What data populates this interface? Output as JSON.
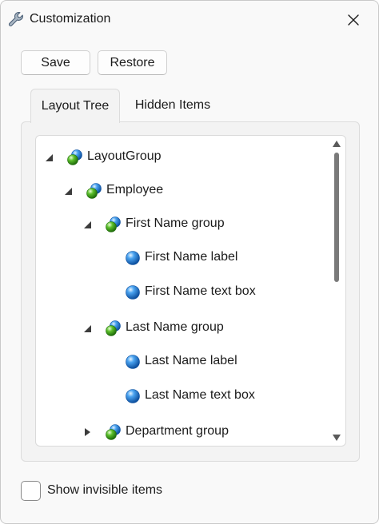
{
  "window": {
    "title": "Customization",
    "icon": "wrench-icon"
  },
  "toolbar": {
    "save_label": "Save",
    "restore_label": "Restore"
  },
  "tabs": [
    {
      "label": "Layout Tree",
      "selected": true
    },
    {
      "label": "Hidden Items",
      "selected": false
    }
  ],
  "tree": {
    "nodes": [
      {
        "label": "LayoutGroup",
        "level": 0,
        "kind": "group",
        "expander": "expanded"
      },
      {
        "label": "Employee",
        "level": 1,
        "kind": "group",
        "expander": "expanded"
      },
      {
        "label": "First Name group",
        "level": 2,
        "kind": "group",
        "expander": "expanded"
      },
      {
        "label": "First Name label",
        "level": 3,
        "kind": "item",
        "expander": "none"
      },
      {
        "label": "First Name text box",
        "level": 3,
        "kind": "item",
        "expander": "none"
      },
      {
        "label": "Last Name group",
        "level": 2,
        "kind": "group",
        "expander": "expanded"
      },
      {
        "label": "Last Name label",
        "level": 3,
        "kind": "item",
        "expander": "none"
      },
      {
        "label": "Last Name text box",
        "level": 3,
        "kind": "item",
        "expander": "none"
      },
      {
        "label": "Department group",
        "level": 2,
        "kind": "group",
        "expander": "collapsed"
      }
    ]
  },
  "footer": {
    "show_invisible_label": "Show invisible items",
    "show_invisible_checked": false
  }
}
